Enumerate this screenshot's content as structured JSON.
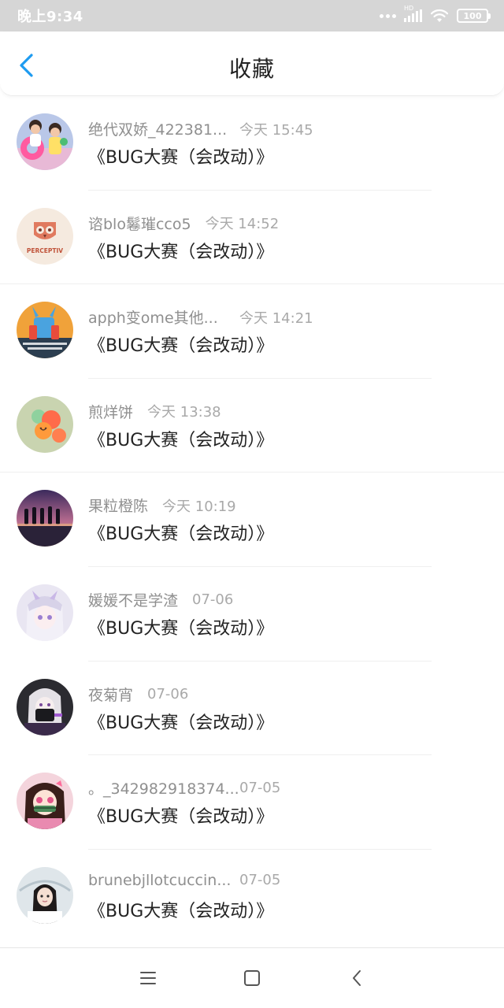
{
  "status_bar": {
    "time": "晚上9:34",
    "signal_tag": "HD",
    "battery": "100"
  },
  "header": {
    "title": "收藏"
  },
  "items": [
    {
      "name": "绝代双娇_422381...",
      "time": "今天 15:45",
      "title": "《BUG大赛（会改动）》"
    },
    {
      "name": "谘blo鬈璀cco5",
      "time": "今天 14:52",
      "title": "《BUG大赛（会改动）》"
    },
    {
      "name": "apph变ome其他...",
      "time": "今天 14:21",
      "title": "《BUG大赛（会改动）》"
    },
    {
      "name": "煎烊饼",
      "time": "今天 13:38",
      "title": "《BUG大赛（会改动）》"
    },
    {
      "name": "果粒橙陈",
      "time": "今天 10:19",
      "title": "《BUG大赛（会改动）》"
    },
    {
      "name": "媛媛不是学渣",
      "time": "07-06",
      "title": "《BUG大赛（会改动）》"
    },
    {
      "name": "夜菊宵",
      "time": "07-06",
      "title": "《BUG大赛（会改动）》"
    },
    {
      "name": "。_342982918374...",
      "time": "07-05",
      "title": "《BUG大赛（会改动）》"
    },
    {
      "name": "brunebjllotcuccin...",
      "time": "07-05",
      "title": "《BUG大赛（会改动）》"
    }
  ],
  "avatar_texts": {
    "perceptiv": "PERCEPTIV"
  },
  "icons": {
    "back": "chevron-left-icon",
    "nav_menu": "menu-icon",
    "nav_home": "square-home-icon",
    "nav_back": "chevron-left-icon"
  },
  "colors": {
    "accent": "#1e9bf0",
    "status_bar_bg": "#d6d6d6",
    "title_text": "#222222",
    "meta_text": "#8f8f8f"
  }
}
